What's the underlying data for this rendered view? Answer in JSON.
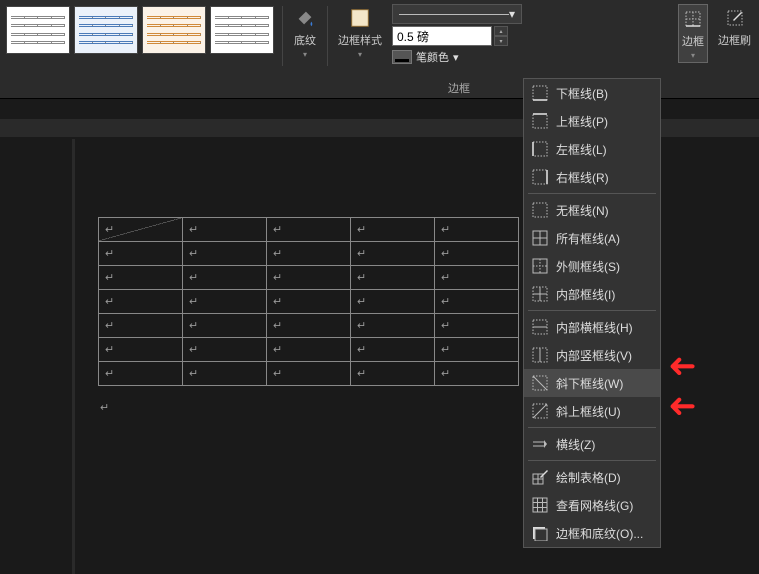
{
  "ribbon": {
    "shading_label": "底纹",
    "border_style_label": "边框样式",
    "weight_value": "0.5 磅",
    "pen_color_label": "笔颜色",
    "borders_label": "边框",
    "border_painter_label": "边框刷",
    "group_borders": "边框"
  },
  "table": {
    "cell_mark": "↵"
  },
  "menu": {
    "items": [
      {
        "label": "下框线(B)"
      },
      {
        "label": "上框线(P)"
      },
      {
        "label": "左框线(L)"
      },
      {
        "label": "右框线(R)"
      },
      {
        "label": "无框线(N)"
      },
      {
        "label": "所有框线(A)"
      },
      {
        "label": "外侧框线(S)"
      },
      {
        "label": "内部框线(I)"
      },
      {
        "label": "内部横框线(H)"
      },
      {
        "label": "内部竖框线(V)"
      },
      {
        "label": "斜下框线(W)"
      },
      {
        "label": "斜上框线(U)"
      },
      {
        "label": "横线(Z)"
      },
      {
        "label": "绘制表格(D)"
      },
      {
        "label": "查看网格线(G)"
      },
      {
        "label": "边框和底纹(O)..."
      }
    ]
  }
}
